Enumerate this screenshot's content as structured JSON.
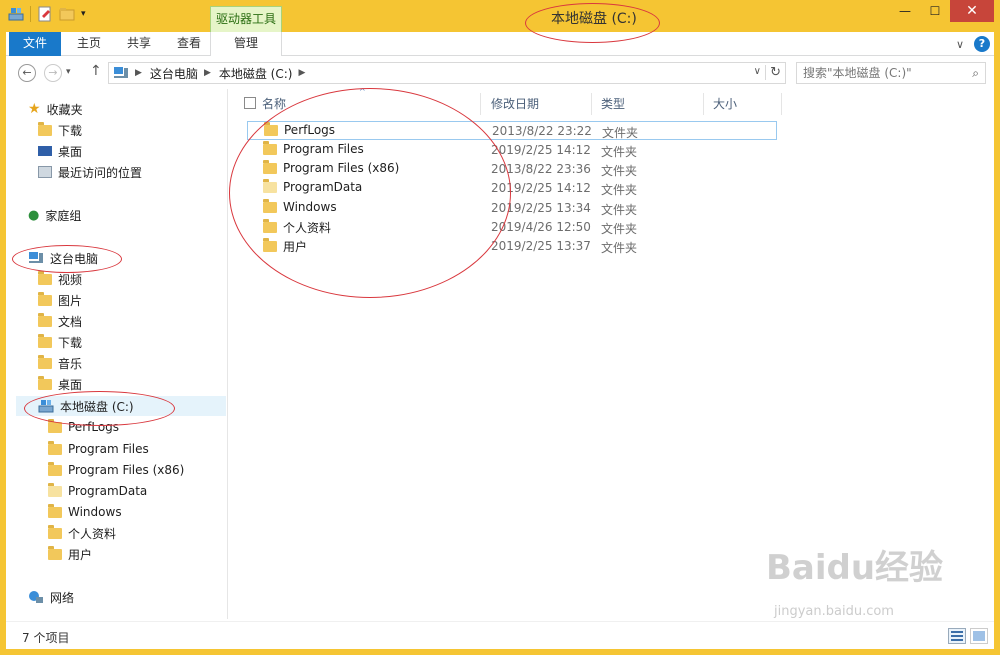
{
  "window": {
    "title": "本地磁盘 (C:)",
    "contextual_tab_group": "驱动器工具"
  },
  "ribbon": {
    "tabs": [
      "文件",
      "主页",
      "共享",
      "查看",
      "管理"
    ]
  },
  "address": {
    "crumbs": [
      "这台电脑",
      "本地磁盘 (C:)"
    ],
    "search_placeholder": "搜索\"本地磁盘 (C:)\""
  },
  "nav": {
    "favorites": {
      "label": "收藏夹",
      "items": [
        "下载",
        "桌面",
        "最近访问的位置"
      ]
    },
    "homegroup": "家庭组",
    "this_pc": {
      "label": "这台电脑",
      "items": [
        "视频",
        "图片",
        "文档",
        "下载",
        "音乐",
        "桌面"
      ]
    },
    "drive": {
      "label": "本地磁盘 (C:)",
      "items": [
        "PerfLogs",
        "Program Files",
        "Program Files (x86)",
        "ProgramData",
        "Windows",
        "个人资料",
        "用户"
      ]
    },
    "network": "网络"
  },
  "columns": [
    "名称",
    "修改日期",
    "类型",
    "大小"
  ],
  "files": [
    {
      "name": "PerfLogs",
      "date": "2013/8/22 23:22",
      "type": "文件夹"
    },
    {
      "name": "Program Files",
      "date": "2019/2/25 14:12",
      "type": "文件夹"
    },
    {
      "name": "Program Files (x86)",
      "date": "2013/8/22 23:36",
      "type": "文件夹"
    },
    {
      "name": "ProgramData",
      "date": "2019/2/25 14:12",
      "type": "文件夹"
    },
    {
      "name": "Windows",
      "date": "2019/2/25 13:34",
      "type": "文件夹"
    },
    {
      "name": "个人资料",
      "date": "2019/4/26 12:50",
      "type": "文件夹"
    },
    {
      "name": "用户",
      "date": "2019/2/25 13:37",
      "type": "文件夹"
    }
  ],
  "status": "7 个项目",
  "watermark": {
    "brand": "Baidu经验",
    "url": "jingyan.baidu.com"
  },
  "colors": {
    "titlebar": "#f5c533",
    "file_tab": "#1979ca",
    "annotation": "#d9383e",
    "selection": "#e5f3fb"
  }
}
